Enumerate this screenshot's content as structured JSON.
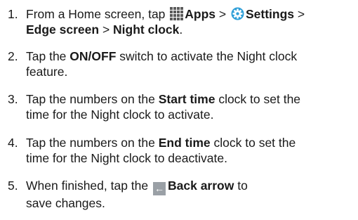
{
  "steps": [
    {
      "number": "1.",
      "line1": {
        "t1": "From a Home screen, tap ",
        "apps": "Apps",
        "t2": " > ",
        "settings": "Settings",
        "t3": " >"
      },
      "line2": {
        "edge": "Edge screen",
        "t1": " > ",
        "night": "Night clock",
        "t2": "."
      }
    },
    {
      "number": "2.",
      "line1": {
        "t1": "Tap the ",
        "onoff": "ON/OFF",
        "t2": " switch to activate the Night clock"
      },
      "line2": "feature."
    },
    {
      "number": "3.",
      "line1": {
        "t1": "Tap the numbers on the ",
        "start": "Start time",
        "t2": " clock to set the"
      },
      "line2": "time for the Night clock to activate."
    },
    {
      "number": "4.",
      "line1": {
        "t1": "Tap the numbers on the ",
        "end": "End time",
        "t2": " clock to set the"
      },
      "line2": "time for the Night clock to deactivate."
    },
    {
      "number": "5.",
      "line1": {
        "t1": "When finished, tap the ",
        "back": "Back arrow",
        "t2": " to"
      },
      "line2": "save changes."
    }
  ],
  "icons": {
    "apps": "apps-grid-icon",
    "settings": "settings-gear-icon",
    "back": "back-arrow-icon",
    "back_glyph": "←"
  },
  "colors": {
    "text": "#1a1a1a",
    "apps_icon": "#5b5b5b",
    "settings_icon_outer": "#2f9fd8",
    "settings_icon_inner": "#ffffff",
    "back_icon_bg": "#9aa0a6"
  }
}
